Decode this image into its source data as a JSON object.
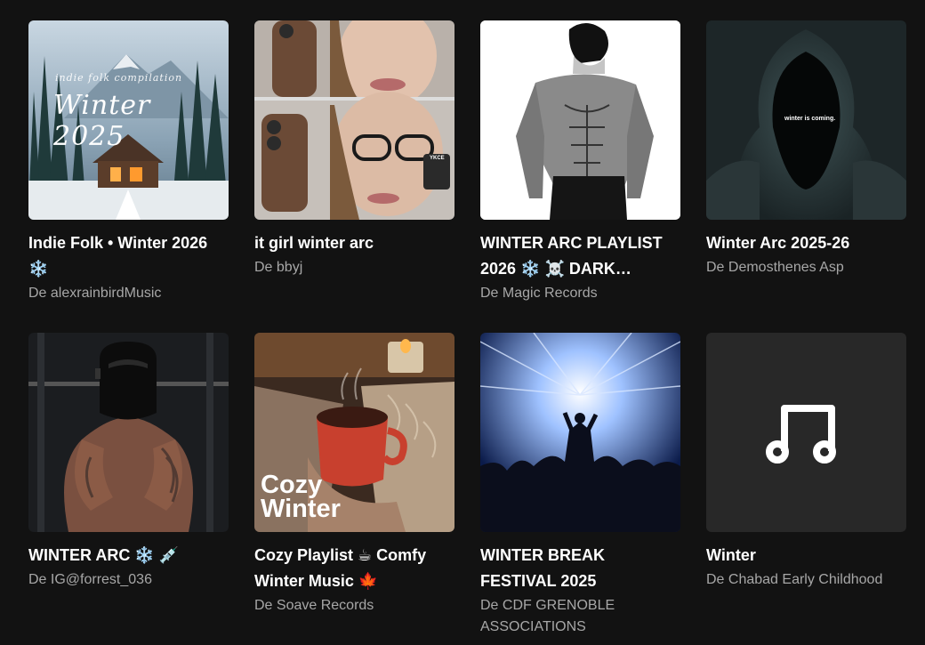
{
  "playlists": [
    {
      "title": "Indie Folk • Winter 2026 ❄️",
      "subtitle": "De alexrainbirdMusic",
      "cover": {
        "type": "image",
        "scene": "snowy-cabin",
        "overlay_top": "indie folk compilation",
        "overlay_main": "Winter 2025"
      }
    },
    {
      "title": "it girl winter arc",
      "subtitle": "De bbyj",
      "cover": {
        "type": "image",
        "scene": "girl-phone-glasses",
        "phone_label": "YKCE"
      }
    },
    {
      "title": "WINTER ARC PLAYLIST 2026 ❄️ ☠️ DARK…",
      "subtitle": "De Magic Records",
      "cover": {
        "type": "image",
        "scene": "muscular-figure-sketch"
      }
    },
    {
      "title": "Winter Arc 2025-26",
      "subtitle": "De Demosthenes Asp",
      "cover": {
        "type": "image",
        "scene": "hooded-figure",
        "overlay_main": "winter is coming."
      }
    },
    {
      "title": "WINTER ARC ❄️ 💉",
      "subtitle": "De IG@forrest_036",
      "cover": {
        "type": "image",
        "scene": "masked-bodybuilder"
      }
    },
    {
      "title": "Cozy Playlist ☕ Comfy Winter Music 🍁",
      "subtitle": "De Soave Records",
      "cover": {
        "type": "image",
        "scene": "red-mug-candle",
        "overlay_main": "Cozy Winter"
      }
    },
    {
      "title": "WINTER BREAK FESTIVAL 2025",
      "subtitle": "De CDF GRENOBLE ASSOCIATIONS",
      "cover": {
        "type": "image",
        "scene": "concert-crowd"
      }
    },
    {
      "title": "Winter",
      "subtitle": "De Chabad Early Childhood",
      "cover": {
        "type": "placeholder",
        "icon": "music-note-icon"
      }
    }
  ],
  "colors": {
    "background": "#121212",
    "title": "#ffffff",
    "subtitle": "#a7a7a7",
    "placeholder_cover": "#282828"
  }
}
